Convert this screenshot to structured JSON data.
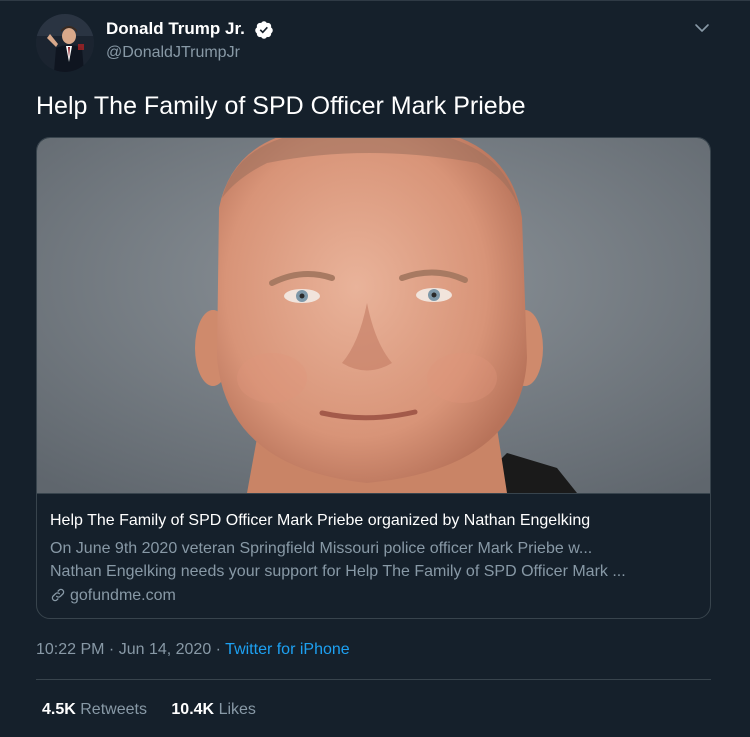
{
  "author": {
    "name": "Donald Trump Jr.",
    "handle": "@DonaldJTrumpJr",
    "verified_icon": "verified-badge-icon",
    "menu_icon": "chevron-down-icon"
  },
  "tweet": {
    "text": "Help The Family of SPD Officer Mark Priebe"
  },
  "card": {
    "image_icon": "photo-of-man-portrait",
    "title": "Help The Family of SPD Officer Mark Priebe organized by Nathan Engelking",
    "description_line1": "On June 9th 2020 veteran Springfield Missouri police officer Mark Priebe w...",
    "description_line2": "Nathan Engelking needs your support for Help The Family of SPD Officer Mark ...",
    "domain": "gofundme.com",
    "link_icon": "link-icon"
  },
  "meta": {
    "time": "10:22 PM",
    "sep1": " · ",
    "date": "Jun 14, 2020",
    "sep2": " · ",
    "source": "Twitter for iPhone"
  },
  "stats": {
    "retweets_count": "4.5K",
    "retweets_label": "Retweets",
    "likes_count": "10.4K",
    "likes_label": "Likes"
  },
  "colors": {
    "background": "#15202b",
    "primary_text": "#ffffff",
    "secondary_text": "#8899a6",
    "accent": "#1da1f2",
    "border": "#38444d"
  }
}
